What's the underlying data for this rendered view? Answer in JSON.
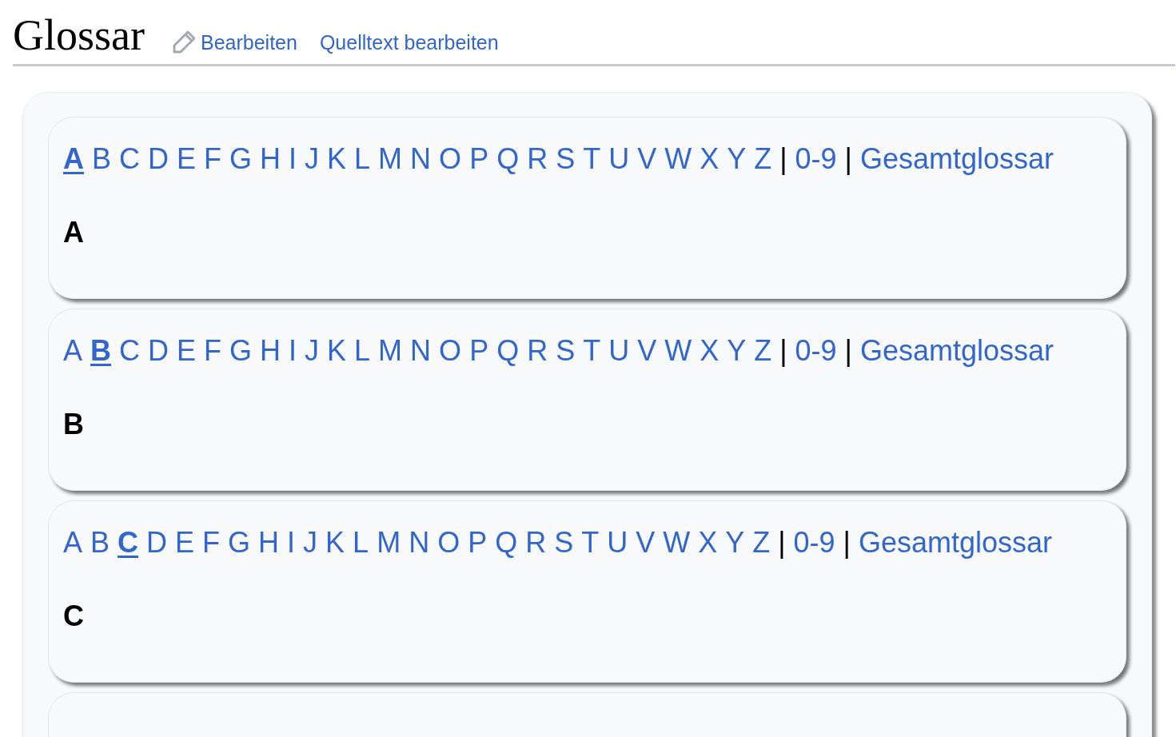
{
  "page": {
    "title": "Glossar",
    "edit_links": [
      {
        "label": "Bearbeiten",
        "kind": "icon"
      },
      {
        "label": "Quelltext bearbeiten",
        "kind": "plain"
      }
    ]
  },
  "sections": [
    {
      "heading": "A",
      "nav": [
        {
          "kind": "letter",
          "label": "A",
          "selected": true
        },
        {
          "kind": "letter",
          "label": "B",
          "selected": false
        },
        {
          "kind": "letter",
          "label": "C",
          "selected": false
        },
        {
          "kind": "letter",
          "label": "D",
          "selected": false
        },
        {
          "kind": "letter",
          "label": "E",
          "selected": false
        },
        {
          "kind": "letter",
          "label": "F",
          "selected": false
        },
        {
          "kind": "letter",
          "label": "G",
          "selected": false
        },
        {
          "kind": "letter",
          "label": "H",
          "selected": false
        },
        {
          "kind": "letter",
          "label": "I",
          "selected": false
        },
        {
          "kind": "letter",
          "label": "J",
          "selected": false
        },
        {
          "kind": "letter",
          "label": "K",
          "selected": false
        },
        {
          "kind": "letter",
          "label": "L",
          "selected": false
        },
        {
          "kind": "letter",
          "label": "M",
          "selected": false
        },
        {
          "kind": "letter",
          "label": "N",
          "selected": false
        },
        {
          "kind": "letter",
          "label": "O",
          "selected": false
        },
        {
          "kind": "letter",
          "label": "P",
          "selected": false
        },
        {
          "kind": "letter",
          "label": "Q",
          "selected": false
        },
        {
          "kind": "letter",
          "label": "R",
          "selected": false
        },
        {
          "kind": "letter",
          "label": "S",
          "selected": false
        },
        {
          "kind": "letter",
          "label": "T",
          "selected": false
        },
        {
          "kind": "letter",
          "label": "U",
          "selected": false
        },
        {
          "kind": "letter",
          "label": "V",
          "selected": false
        },
        {
          "kind": "letter",
          "label": "W",
          "selected": false
        },
        {
          "kind": "letter",
          "label": "X",
          "selected": false
        },
        {
          "kind": "letter",
          "label": "Y",
          "selected": false
        },
        {
          "kind": "letter",
          "label": "Z",
          "selected": false
        },
        {
          "kind": "separator",
          "label": "|"
        },
        {
          "kind": "letter",
          "label": "0-9",
          "selected": false
        },
        {
          "kind": "separator",
          "label": "|"
        },
        {
          "kind": "letter",
          "label": "Gesamtglossar",
          "selected": false
        }
      ]
    },
    {
      "heading": "B",
      "nav": [
        {
          "kind": "letter",
          "label": "A",
          "selected": false
        },
        {
          "kind": "letter",
          "label": "B",
          "selected": true
        },
        {
          "kind": "letter",
          "label": "C",
          "selected": false
        },
        {
          "kind": "letter",
          "label": "D",
          "selected": false
        },
        {
          "kind": "letter",
          "label": "E",
          "selected": false
        },
        {
          "kind": "letter",
          "label": "F",
          "selected": false
        },
        {
          "kind": "letter",
          "label": "G",
          "selected": false
        },
        {
          "kind": "letter",
          "label": "H",
          "selected": false
        },
        {
          "kind": "letter",
          "label": "I",
          "selected": false
        },
        {
          "kind": "letter",
          "label": "J",
          "selected": false
        },
        {
          "kind": "letter",
          "label": "K",
          "selected": false
        },
        {
          "kind": "letter",
          "label": "L",
          "selected": false
        },
        {
          "kind": "letter",
          "label": "M",
          "selected": false
        },
        {
          "kind": "letter",
          "label": "N",
          "selected": false
        },
        {
          "kind": "letter",
          "label": "O",
          "selected": false
        },
        {
          "kind": "letter",
          "label": "P",
          "selected": false
        },
        {
          "kind": "letter",
          "label": "Q",
          "selected": false
        },
        {
          "kind": "letter",
          "label": "R",
          "selected": false
        },
        {
          "kind": "letter",
          "label": "S",
          "selected": false
        },
        {
          "kind": "letter",
          "label": "T",
          "selected": false
        },
        {
          "kind": "letter",
          "label": "U",
          "selected": false
        },
        {
          "kind": "letter",
          "label": "V",
          "selected": false
        },
        {
          "kind": "letter",
          "label": "W",
          "selected": false
        },
        {
          "kind": "letter",
          "label": "X",
          "selected": false
        },
        {
          "kind": "letter",
          "label": "Y",
          "selected": false
        },
        {
          "kind": "letter",
          "label": "Z",
          "selected": false
        },
        {
          "kind": "separator",
          "label": "|"
        },
        {
          "kind": "letter",
          "label": "0-9",
          "selected": false
        },
        {
          "kind": "separator",
          "label": "|"
        },
        {
          "kind": "letter",
          "label": "Gesamtglossar",
          "selected": false
        }
      ]
    },
    {
      "heading": "C",
      "nav": [
        {
          "kind": "letter",
          "label": "A",
          "selected": false
        },
        {
          "kind": "letter",
          "label": "B",
          "selected": false
        },
        {
          "kind": "letter",
          "label": "C",
          "selected": true
        },
        {
          "kind": "letter",
          "label": "D",
          "selected": false
        },
        {
          "kind": "letter",
          "label": "E",
          "selected": false
        },
        {
          "kind": "letter",
          "label": "F",
          "selected": false
        },
        {
          "kind": "letter",
          "label": "G",
          "selected": false
        },
        {
          "kind": "letter",
          "label": "H",
          "selected": false
        },
        {
          "kind": "letter",
          "label": "I",
          "selected": false
        },
        {
          "kind": "letter",
          "label": "J",
          "selected": false
        },
        {
          "kind": "letter",
          "label": "K",
          "selected": false
        },
        {
          "kind": "letter",
          "label": "L",
          "selected": false
        },
        {
          "kind": "letter",
          "label": "M",
          "selected": false
        },
        {
          "kind": "letter",
          "label": "N",
          "selected": false
        },
        {
          "kind": "letter",
          "label": "O",
          "selected": false
        },
        {
          "kind": "letter",
          "label": "P",
          "selected": false
        },
        {
          "kind": "letter",
          "label": "Q",
          "selected": false
        },
        {
          "kind": "letter",
          "label": "R",
          "selected": false
        },
        {
          "kind": "letter",
          "label": "S",
          "selected": false
        },
        {
          "kind": "letter",
          "label": "T",
          "selected": false
        },
        {
          "kind": "letter",
          "label": "U",
          "selected": false
        },
        {
          "kind": "letter",
          "label": "V",
          "selected": false
        },
        {
          "kind": "letter",
          "label": "W",
          "selected": false
        },
        {
          "kind": "letter",
          "label": "X",
          "selected": false
        },
        {
          "kind": "letter",
          "label": "Y",
          "selected": false
        },
        {
          "kind": "letter",
          "label": "Z",
          "selected": false
        },
        {
          "kind": "separator",
          "label": "|"
        },
        {
          "kind": "letter",
          "label": "0-9",
          "selected": false
        },
        {
          "kind": "separator",
          "label": "|"
        },
        {
          "kind": "letter",
          "label": "Gesamtglossar",
          "selected": false
        }
      ]
    }
  ]
}
